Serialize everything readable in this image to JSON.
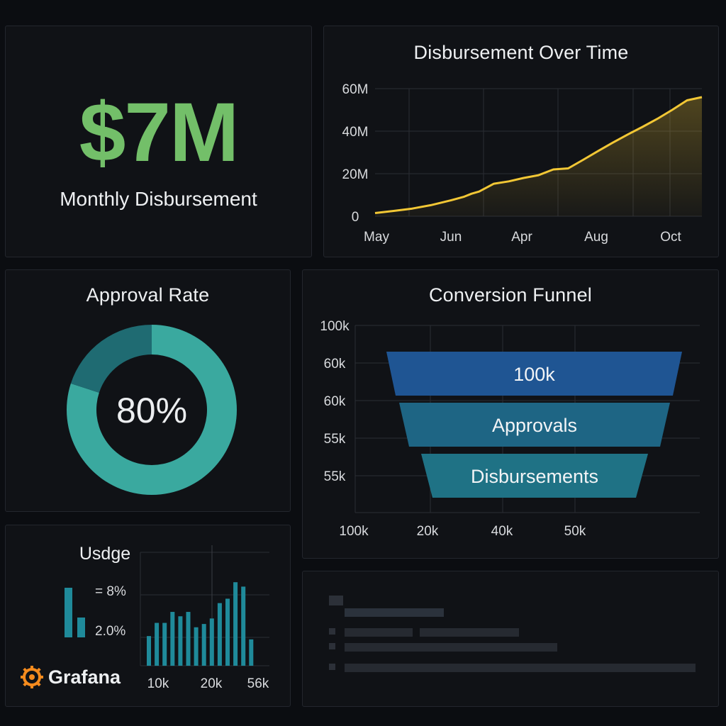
{
  "stat_panel": {
    "value": "$7M",
    "label": "Monthly Disbursement"
  },
  "line_panel": {
    "title": "Disbursement Over Time",
    "chart_data": {
      "type": "area",
      "title": "Disbursement Over Time",
      "y_ticks": [
        "0",
        "20M",
        "40M",
        "60M"
      ],
      "x_ticks": [
        "May",
        "Jun",
        "Apr",
        "Aug",
        "Oct"
      ],
      "ylim": [
        0,
        60
      ],
      "y_unit": "M",
      "x": [
        0,
        0.5,
        1,
        1.5,
        2,
        2.4,
        2.6,
        2.8,
        3.2,
        3.6,
        4,
        4.4,
        4.8,
        5.2,
        5.6,
        6,
        6.4,
        6.8,
        7.2,
        7.6,
        8,
        8.4,
        8.8
      ],
      "values": [
        1.5,
        2.5,
        3.6,
        5.2,
        7.3,
        9.2,
        10.6,
        11.6,
        15.3,
        16.4,
        18,
        19.3,
        22,
        22.5,
        26.5,
        30.6,
        34.6,
        38.4,
        42,
        45.8,
        50,
        54.5,
        56
      ],
      "color": "#f2c735",
      "grid": true
    }
  },
  "approval_panel": {
    "title": "Approval Rate",
    "value_text": "80%",
    "chart_data": {
      "type": "pie",
      "values": [
        80,
        20
      ],
      "colors": [
        "#3aa99f",
        "#1f6b72"
      ]
    }
  },
  "funnel_panel": {
    "title": "Conversion Funnel",
    "chart_data": {
      "type": "bar",
      "subtype": "funnel",
      "y_ticks": [
        "100k",
        "60k",
        "60k",
        "55k",
        "55k"
      ],
      "x_ticks": [
        "100k",
        "20k",
        "40k",
        "50k"
      ],
      "stages": [
        {
          "label": "100k",
          "color": "#1f5593"
        },
        {
          "label": "Approvals",
          "color": "#1e6584"
        },
        {
          "label": "Disbursements",
          "color": "#1f7285"
        }
      ]
    }
  },
  "usage_panel": {
    "title": "Usdge",
    "legend": [
      "= 8%",
      "2.0%"
    ],
    "brand": "Grafana",
    "chart_data": {
      "type": "bar",
      "x_ticks": [
        "10k",
        "20k",
        "56k"
      ],
      "mini_values": [
        70,
        28
      ],
      "values": [
        27,
        39,
        39,
        49,
        45,
        49,
        35,
        38,
        43,
        57,
        61,
        76,
        72,
        24
      ],
      "color": "#1f8a9a"
    }
  },
  "logs_panel": {
    "rows": [
      {
        "bullet": true,
        "bars": []
      },
      {
        "bullet": false,
        "bars": [
          140
        ]
      },
      {
        "bullet": true,
        "bars": [
          96,
          140
        ]
      },
      {
        "bullet": true,
        "bars": [
          300
        ]
      },
      {
        "bullet": true,
        "bars": [
          495
        ]
      }
    ]
  }
}
